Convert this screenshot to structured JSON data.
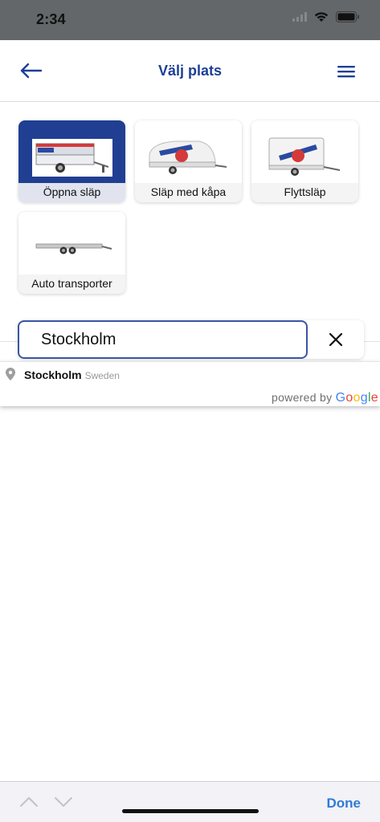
{
  "status_bar": {
    "time": "2:34"
  },
  "header": {
    "title": "Välj plats"
  },
  "trailer_types": [
    {
      "label": "Öppna släp",
      "selected": true
    },
    {
      "label": "Släp med kåpa",
      "selected": false
    },
    {
      "label": "Flyttsläp",
      "selected": false
    },
    {
      "label": "Auto transporter",
      "selected": false
    }
  ],
  "search": {
    "value": "Stockholm",
    "placeholder": ""
  },
  "suggestions": [
    {
      "main": "Stockholm",
      "secondary": "Sweden"
    }
  ],
  "attribution": {
    "prefix": "powered by",
    "brand": "Google"
  },
  "keyboard_toolbar": {
    "done_label": "Done"
  },
  "colors": {
    "brand": "#1d3f97",
    "selected_card": "#203e92",
    "done": "#2f7bd8"
  }
}
